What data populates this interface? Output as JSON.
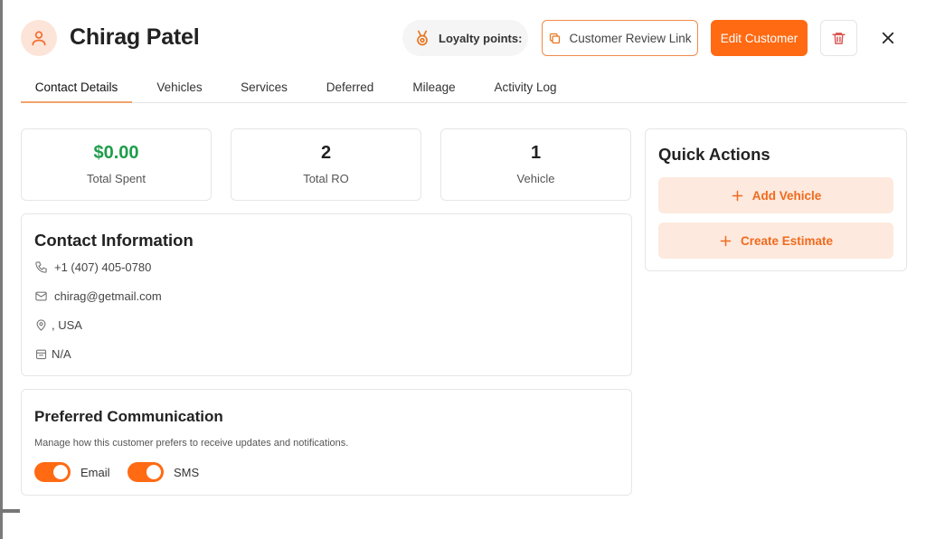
{
  "header": {
    "customer_name": "Chirag Patel",
    "loyalty_label": "Loyalty points:",
    "review_link_label": "Customer Review Link",
    "edit_label": "Edit Customer"
  },
  "tabs": [
    {
      "label": "Contact Details",
      "active": true
    },
    {
      "label": "Vehicles",
      "active": false
    },
    {
      "label": "Services",
      "active": false
    },
    {
      "label": "Deferred",
      "active": false
    },
    {
      "label": "Mileage",
      "active": false
    },
    {
      "label": "Activity Log",
      "active": false
    }
  ],
  "stats": [
    {
      "value": "$0.00",
      "label": "Total Spent"
    },
    {
      "value": "2",
      "label": "Total RO"
    },
    {
      "value": "1",
      "label": "Vehicle"
    }
  ],
  "contact": {
    "title": "Contact Information",
    "phone": "+1 (407) 405-0780",
    "email": "chirag@getmail.com",
    "address": ", USA",
    "other": "N/A"
  },
  "communication": {
    "title": "Preferred Communication",
    "description": "Manage how this customer prefers to receive updates and notifications.",
    "channels": [
      {
        "label": "Email",
        "enabled": true
      },
      {
        "label": "SMS",
        "enabled": true
      }
    ]
  },
  "quick_actions": {
    "title": "Quick Actions",
    "add_vehicle": "Add Vehicle",
    "create_estimate": "Create Estimate"
  },
  "colors": {
    "accent": "#ff6a13",
    "accent_soft": "#fde9de",
    "success": "#1f9d4c"
  },
  "icons": [
    "user-icon",
    "medal-icon",
    "copy-link-icon",
    "trash-icon",
    "close-icon",
    "phone-icon",
    "mail-icon",
    "location-icon",
    "calendar-icon",
    "plus-icon"
  ]
}
